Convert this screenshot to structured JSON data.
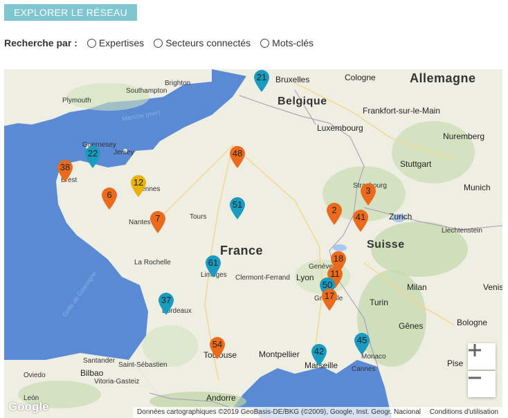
{
  "header": {
    "explore_button": "EXPLORER LE RÉSEAU"
  },
  "search": {
    "label": "Recherche par :",
    "options": [
      "Expertises",
      "Secteurs connectés",
      "Mots-clés"
    ],
    "selected": null
  },
  "map": {
    "countries": [
      "Allemagne",
      "Belgique",
      "France",
      "Suisse"
    ],
    "cities": [
      "Bruxelles",
      "Cologne",
      "Frankfort-sur-le-Main",
      "Luxembourg",
      "Nuremberg",
      "Stuttgart",
      "Strasbourg",
      "Munich",
      "Zurich",
      "Liechtenstein",
      "Brighton",
      "Southampton",
      "Plymouth",
      "Guernesey",
      "Jersey",
      "Brest",
      "Rennes",
      "Nantes",
      "Tours",
      "La Rochelle",
      "Limoges",
      "Clermont-Ferrand",
      "Genève",
      "Lyon",
      "Grenoble",
      "Milan",
      "Turin",
      "Venise",
      "Gênes",
      "Bologne",
      "Bordeaux",
      "Toulouse",
      "Montpellier",
      "Marseille",
      "Monaco",
      "Cannes",
      "Santander",
      "Bilbao",
      "Saint-Sébastien",
      "Vitoria-Gasteiz",
      "Oviedo",
      "León",
      "Andorre",
      "Pise"
    ],
    "sea_labels": [
      "Manche (mer)",
      "Golfe de Gascogne"
    ],
    "markers": [
      {
        "label": "21",
        "color": "#1a9bc0"
      },
      {
        "label": "22",
        "color": "#1a9bc0"
      },
      {
        "label": "38",
        "color": "#ec6a1b"
      },
      {
        "label": "12",
        "color": "#e8b20f"
      },
      {
        "label": "6",
        "color": "#ec6a1b"
      },
      {
        "label": "7",
        "color": "#ec6a1b"
      },
      {
        "label": "48",
        "color": "#ec6a1b"
      },
      {
        "label": "51",
        "color": "#1a9bc0"
      },
      {
        "label": "61",
        "color": "#1a9bc0"
      },
      {
        "label": "37",
        "color": "#1a9bc0"
      },
      {
        "label": "54",
        "color": "#ec6a1b"
      },
      {
        "label": "42",
        "color": "#1a9bc0"
      },
      {
        "label": "45",
        "color": "#1a9bc0"
      },
      {
        "label": "3",
        "color": "#ec6a1b"
      },
      {
        "label": "2",
        "color": "#ec6a1b"
      },
      {
        "label": "41",
        "color": "#ec6a1b"
      },
      {
        "label": "18",
        "color": "#ec6a1b"
      },
      {
        "label": "11",
        "color": "#ec6a1b"
      },
      {
        "label": "50",
        "color": "#1a9bc0"
      },
      {
        "label": "17",
        "color": "#ec6a1b"
      }
    ],
    "zoom_in": "+",
    "zoom_out": "−",
    "google_logo": "Google",
    "attribution": "Données cartographiques ©2019 GeoBasis-DE/BKG (©2009), Google, Inst. Geogr. Nacional",
    "terms": "Conditions d'utilisation"
  }
}
